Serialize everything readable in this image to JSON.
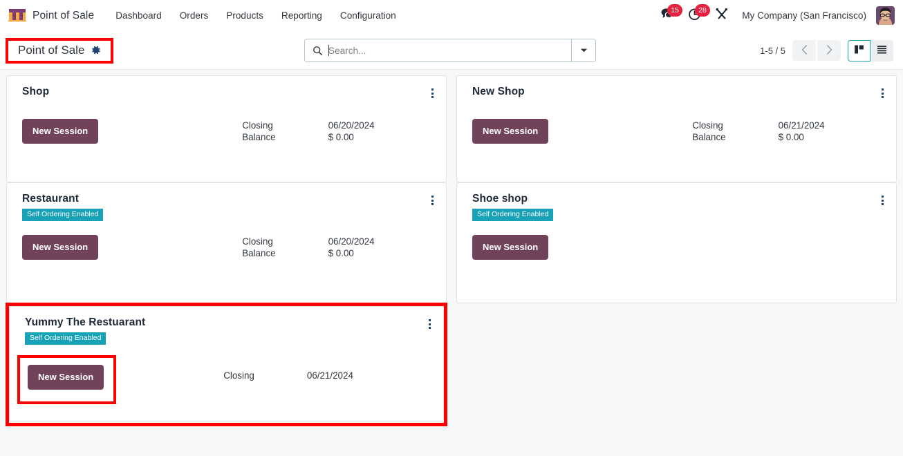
{
  "navbar": {
    "brand": "Point of Sale",
    "brand_logo_icon": "shop-awning-icon",
    "menu": [
      {
        "label": "Dashboard"
      },
      {
        "label": "Orders"
      },
      {
        "label": "Products"
      },
      {
        "label": "Reporting"
      },
      {
        "label": "Configuration"
      }
    ],
    "messages_icon": "chat-bubble-icon",
    "messages_count": "15",
    "activities_icon": "clock-activity-icon",
    "activities_count": "28",
    "apps_icon": "tools-wrench-icon",
    "company": "My Company (San Francisco)",
    "avatar_icon": "user-avatar"
  },
  "controlpanel": {
    "breadcrumb_title": "Point of Sale",
    "settings_icon": "gear-icon",
    "search": {
      "icon": "search-icon",
      "placeholder": "Search...",
      "value": "",
      "toggle_icon": "caret-down-icon"
    },
    "pager": {
      "count": "1-5 / 5",
      "prev_icon": "chevron-left-icon",
      "next_icon": "chevron-right-icon"
    },
    "views": [
      {
        "name": "kanban",
        "icon": "kanban-icon",
        "active": true
      },
      {
        "name": "list",
        "icon": "list-icon",
        "active": false
      }
    ]
  },
  "colors": {
    "accent_teal": "#17a2b8",
    "button_plum": "#71435b",
    "badge_red": "#e6213f",
    "highlight_red": "#fc0000",
    "page_bg": "#f7f8fa"
  },
  "kanban": {
    "new_session_label": "New Session",
    "self_ordering_badge": "Self Ordering Enabled",
    "closing_label": "Closing",
    "balance_label": "Balance",
    "cards": [
      {
        "title": "Shop",
        "self_ordering": false,
        "closing": "06/20/2024",
        "balance": "$ 0.00",
        "highlighted": false
      },
      {
        "title": "New Shop",
        "self_ordering": false,
        "closing": "06/21/2024",
        "balance": "$ 0.00",
        "highlighted": false
      },
      {
        "title": "Restaurant",
        "self_ordering": true,
        "closing": "06/20/2024",
        "balance": "$ 0.00",
        "highlighted": false
      },
      {
        "title": "Shoe shop",
        "self_ordering": true,
        "closing": "",
        "balance": "",
        "highlighted": false
      },
      {
        "title": "Yummy The Restuarant",
        "self_ordering": true,
        "closing": "06/21/2024",
        "balance": "",
        "highlighted": true
      }
    ]
  }
}
